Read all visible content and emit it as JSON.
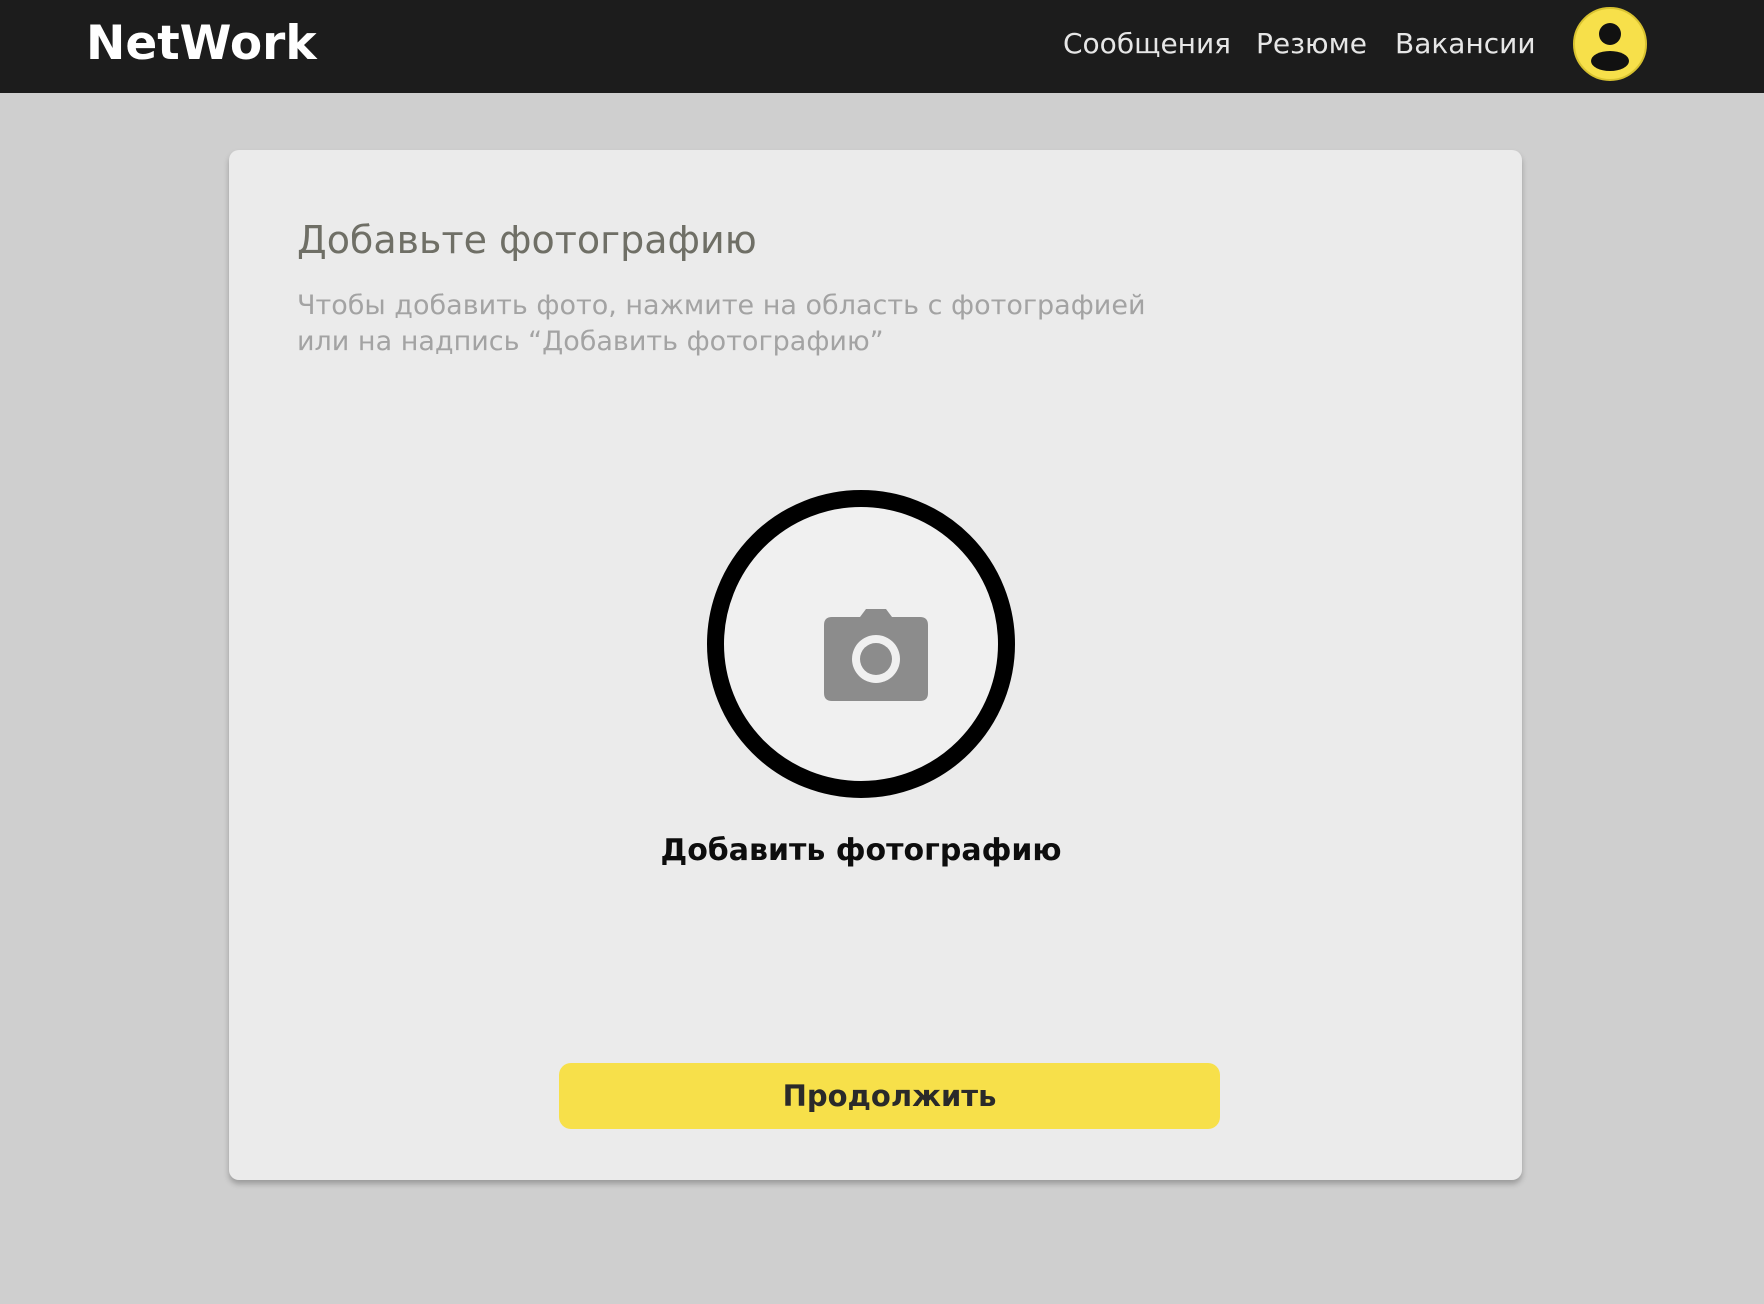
{
  "header": {
    "logo": "NetWork",
    "nav": {
      "messages": "Сообщения",
      "resume": "Резюме",
      "vacancies": "Вакансии"
    },
    "avatar_icon": "user-icon",
    "accent_color": "#f7e04a",
    "background_color": "#1c1c1c"
  },
  "card": {
    "title": "Добавьте фотографию",
    "hint_line_1": "Чтобы добавить фото, нажмите на область с фотографией",
    "hint_line_2": "или на надпись “Добавить фотографию”",
    "photo_icon": "camera-icon",
    "add_photo_label": "Добавить фотографию",
    "continue_label": "Продолжить"
  }
}
